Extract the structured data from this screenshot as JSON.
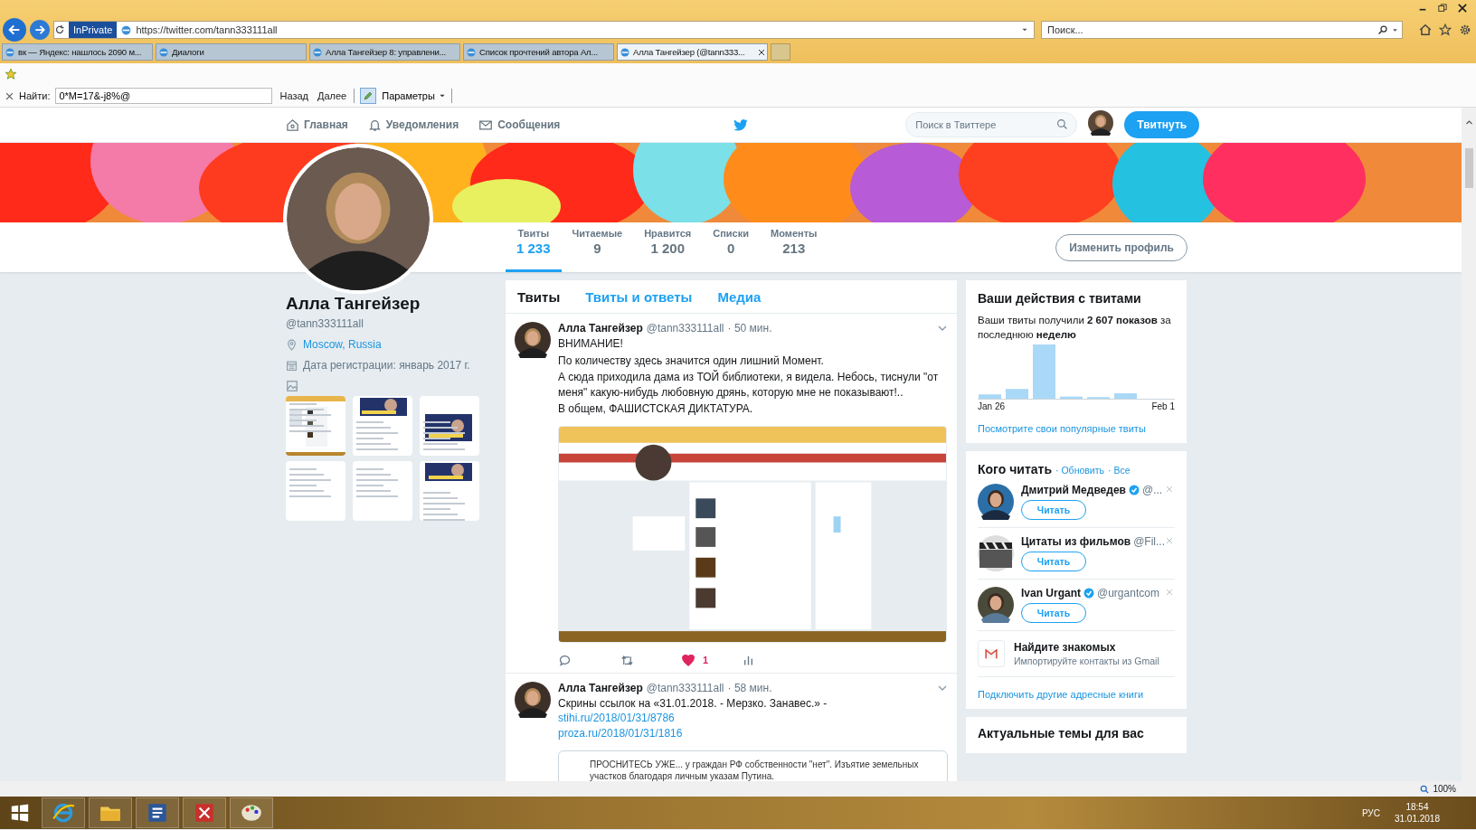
{
  "browser": {
    "private_badge": "InPrivate",
    "address": "https://twitter.com/tann333111all",
    "search_placeholder": "Поиск...",
    "tabs": [
      {
        "label": "вк — Яндекс: нашлось 2090 м...",
        "selected": false
      },
      {
        "label": "Диалоги",
        "selected": false
      },
      {
        "label": "Алла Тангейзер 8: управлени...",
        "selected": false
      },
      {
        "label": "Список прочтений автора Ал...",
        "selected": false
      },
      {
        "label": "Алла Тангейзер (@tann333...",
        "selected": true
      }
    ],
    "find_bar": {
      "label": "Найти:",
      "value": "0*M=17&-j8%@",
      "previous": "Назад",
      "next": "Далее",
      "options": "Параметры"
    }
  },
  "nav": {
    "items": [
      {
        "label": "Главная",
        "kind": "home"
      },
      {
        "label": "Уведомления",
        "kind": "bell"
      },
      {
        "label": "Сообщения",
        "kind": "mail"
      }
    ],
    "search_placeholder": "Поиск в Твиттере",
    "tweet_button": "Твитнуть"
  },
  "stats": [
    {
      "label": "Твиты",
      "value": "1 233",
      "selected": true
    },
    {
      "label": "Читаемые",
      "value": "9",
      "selected": false
    },
    {
      "label": "Нравится",
      "value": "1 200",
      "selected": false
    },
    {
      "label": "Списки",
      "value": "0",
      "selected": false
    },
    {
      "label": "Моменты",
      "value": "213",
      "selected": false
    }
  ],
  "edit_profile": "Изменить профиль",
  "profile": {
    "name": "Алла Тангейзер",
    "handle": "@tann333111all",
    "location": "Moscow, Russia",
    "joined": "Дата регистрации: январь 2017 г.",
    "media": [
      {
        "kind": "picture"
      },
      {
        "kind": "picture"
      },
      {
        "kind": "picture"
      },
      {
        "kind": "picture"
      },
      {
        "kind": "picture"
      },
      {
        "kind": "picture"
      }
    ]
  },
  "timeline_tabs": [
    {
      "label": "Твиты",
      "selected": true
    },
    {
      "label": "Твиты и ответы",
      "selected": false
    },
    {
      "label": "Медиа",
      "selected": false
    }
  ],
  "tweets": [
    {
      "name": "Алла Тангейзер",
      "handle": "@tann333111all",
      "time": "· 50 мин.",
      "paragraphs": [
        "ВНИМАНИЕ!",
        "По количеству здесь значится один лишний Момент.",
        "А сюда приходила дама из ТОЙ библиотеки, я видела. Небось, тиснули \"от меня\" какую-нибудь любовную дрянь, которую мне не показывают!..",
        "В общем, ФАШИСТСКАЯ ДИКТАТУРА."
      ],
      "media": {
        "kind": "picture"
      },
      "liked": true,
      "likes": "1"
    },
    {
      "name": "Алла Тангейзер",
      "handle": "@tann333111all",
      "time": "· 58 мин.",
      "paragraphs": [
        "Скрины ссылок на «31.01.2018. - Мерзко. Занавес.» -"
      ],
      "links": [
        "stihi.ru/2018/01/31/8786",
        "proza.ru/2018/01/31/1816"
      ],
      "card_text": "ПРОСНИТЕСЬ УЖЕ... у граждан РФ собственности \"нет\". Изъятие земельных участков благодаря личным указам Путина."
    }
  ],
  "activity": {
    "title": "Ваши действия с твитами",
    "text": "Ваши твиты получили **2 607 показов** за последнюю **неделю**",
    "start_label": "Jan 26",
    "end_label": "Feb 1",
    "link": "Посмотрите свои популярные твиты"
  },
  "who_to_follow": {
    "title": "Кого читать",
    "refresh": "· Обновить",
    "all": "· Все",
    "accounts": [
      {
        "name": "Дмитрий Медведев",
        "verified": true,
        "handle": "@...",
        "button": "Читать"
      },
      {
        "name": "Цитаты из фильмов",
        "verified": false,
        "handle": "@Fil...",
        "button": "Читать"
      },
      {
        "name": "Ivan Urgant",
        "verified": true,
        "handle": "@urgantcom",
        "button": "Читать"
      }
    ],
    "find_friends": {
      "title": "Найдите знакомых",
      "subtitle": "Импортируйте контакты из Gmail"
    },
    "connect_link": "Подключить другие адресные книги"
  },
  "trends": {
    "title": "Актуальные темы для вас"
  },
  "status_bar": {
    "zoom": "100%"
  },
  "taskbar": {
    "apps": [
      {
        "kind": "ie"
      },
      {
        "kind": "folder"
      },
      {
        "kind": "word"
      },
      {
        "kind": "red-app"
      },
      {
        "kind": "paint"
      }
    ],
    "language": "РУС",
    "time": "18:54",
    "date": "31.01.2018"
  }
}
